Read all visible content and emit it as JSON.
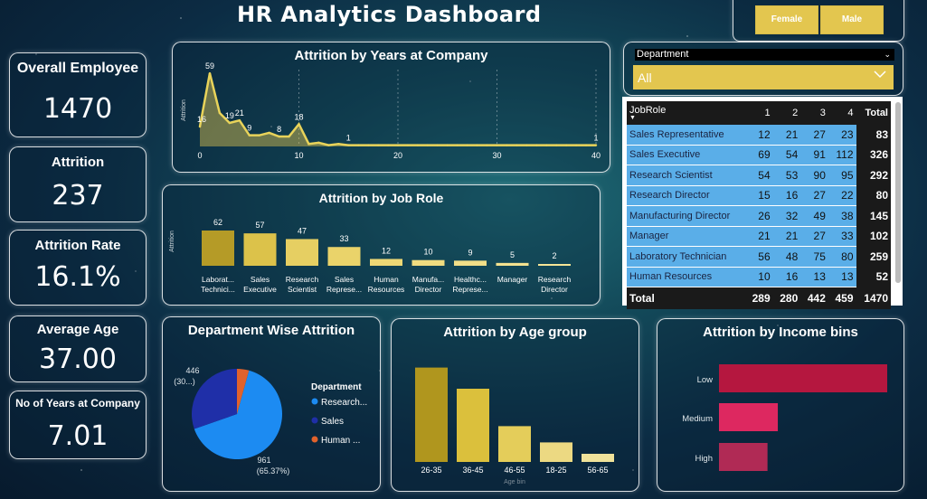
{
  "header": {
    "title": "HR Analytics Dashboard"
  },
  "gender_slicer": {
    "female_label": "Female",
    "male_label": "Male"
  },
  "department_slicer": {
    "label": "Department",
    "selected": "All"
  },
  "kpis": [
    {
      "label": "Overall Employee",
      "value": "1470"
    },
    {
      "label": "Attrition",
      "value": "237"
    },
    {
      "label": "Attrition Rate",
      "value": "16.1%"
    },
    {
      "label": "Average Age",
      "value": "37.00"
    },
    {
      "label": "No of Years at Company",
      "value": "7.01"
    }
  ],
  "matrix": {
    "headers": [
      "JobRole",
      "1",
      "2",
      "3",
      "4",
      "Total"
    ],
    "rows": [
      {
        "role": "Sales Representative",
        "v": [
          "12",
          "21",
          "27",
          "23"
        ],
        "total": "83"
      },
      {
        "role": "Sales Executive",
        "v": [
          "69",
          "54",
          "91",
          "112"
        ],
        "total": "326"
      },
      {
        "role": "Research Scientist",
        "v": [
          "54",
          "53",
          "90",
          "95"
        ],
        "total": "292"
      },
      {
        "role": "Research Director",
        "v": [
          "15",
          "16",
          "27",
          "22"
        ],
        "total": "80"
      },
      {
        "role": "Manufacturing Director",
        "v": [
          "26",
          "32",
          "49",
          "38"
        ],
        "total": "145"
      },
      {
        "role": "Manager",
        "v": [
          "21",
          "21",
          "27",
          "33"
        ],
        "total": "102"
      },
      {
        "role": "Laboratory Technician",
        "v": [
          "56",
          "48",
          "75",
          "80"
        ],
        "total": "259"
      },
      {
        "role": "Human Resources",
        "v": [
          "10",
          "16",
          "13",
          "13"
        ],
        "total": "52"
      }
    ],
    "total": {
      "label": "Total",
      "v": [
        "289",
        "280",
        "442",
        "459"
      ],
      "total": "1470"
    }
  },
  "chart_data": [
    {
      "type": "area",
      "title": "Attrition by Years at Company",
      "ylabel": "Attrition",
      "x": [
        0,
        1,
        2,
        3,
        4,
        5,
        6,
        7,
        8,
        9,
        10,
        11,
        12,
        13,
        14,
        15,
        16,
        17,
        18,
        19,
        20,
        21,
        22,
        23,
        24,
        25,
        26,
        27,
        28,
        29,
        30,
        31,
        32,
        33,
        34,
        35,
        36,
        37,
        38,
        39,
        40
      ],
      "values": [
        16,
        59,
        27,
        19,
        21,
        9,
        9,
        11,
        8,
        8,
        18,
        2,
        3,
        1,
        2,
        1,
        1,
        1,
        1,
        1,
        1,
        1,
        1,
        1,
        1,
        1,
        1,
        1,
        1,
        1,
        1,
        1,
        1,
        1,
        1,
        1,
        1,
        1,
        1,
        1,
        1
      ],
      "point_labels": [
        {
          "x": 0,
          "text": "16"
        },
        {
          "x": 1,
          "text": "59"
        },
        {
          "x": 3,
          "text": "19"
        },
        {
          "x": 4,
          "text": "21"
        },
        {
          "x": 5,
          "text": "9"
        },
        {
          "x": 8,
          "text": "8"
        },
        {
          "x": 10,
          "text": "18"
        },
        {
          "x": 15,
          "text": "1"
        },
        {
          "x": 40,
          "text": "1"
        }
      ],
      "xticks": [
        "0",
        "10",
        "20",
        "30",
        "40"
      ],
      "xlim": [
        0,
        40
      ],
      "ylim": [
        0,
        62
      ]
    },
    {
      "type": "bar",
      "title": "Attrition by Job Role",
      "ylabel": "Attrition",
      "categories": [
        [
          "Laborat...",
          "Technici..."
        ],
        [
          "Sales",
          "Executive"
        ],
        [
          "Research",
          "Scientist"
        ],
        [
          "Sales",
          "Represe..."
        ],
        [
          "Human",
          "Resources"
        ],
        [
          "Manufa...",
          "Director"
        ],
        [
          "Healthc...",
          "Represe..."
        ],
        [
          "Manager"
        ],
        [
          "Research",
          "Director"
        ]
      ],
      "values": [
        62,
        57,
        47,
        33,
        12,
        10,
        9,
        5,
        2
      ],
      "colors": [
        "#b59b27",
        "#dcc24a",
        "#e6cf62",
        "#ead36a",
        "#eed875",
        "#f0dc80",
        "#f2df88",
        "#f4e28f",
        "#f6e596"
      ],
      "ylim": [
        0,
        62
      ]
    },
    {
      "type": "pie",
      "title": "Department Wise Attrition",
      "legend_title": "Department",
      "slices": [
        {
          "name": "Research...",
          "value": 961,
          "label": "961",
          "pct": "(65.37%)",
          "color": "#1c8bf2"
        },
        {
          "name": "Sales",
          "value": 446,
          "label": "446",
          "pct": "(30...)",
          "color": "#1f2fa8"
        },
        {
          "name": "Human ...",
          "value": 63,
          "color": "#e0622c"
        }
      ]
    },
    {
      "type": "bar",
      "title": "Attrition by Age group",
      "xlabel": "Age bin",
      "categories": [
        "26-35",
        "36-45",
        "46-55",
        "18-25",
        "56-65"
      ],
      "values": [
        116,
        90,
        44,
        24,
        10
      ],
      "colors": [
        "#b0961e",
        "#dbc03c",
        "#e4cd5a",
        "#ecd982",
        "#f0e29a"
      ],
      "ylim": [
        0,
        120
      ]
    },
    {
      "type": "bar",
      "orientation": "horizontal",
      "title": "Attrition by Income bins",
      "categories": [
        "Low",
        "Medium",
        "High"
      ],
      "values": [
        163,
        57,
        47
      ],
      "colors": [
        "#b5173f",
        "#dd2860",
        "#b02a55"
      ],
      "xlim": [
        0,
        170
      ]
    }
  ]
}
